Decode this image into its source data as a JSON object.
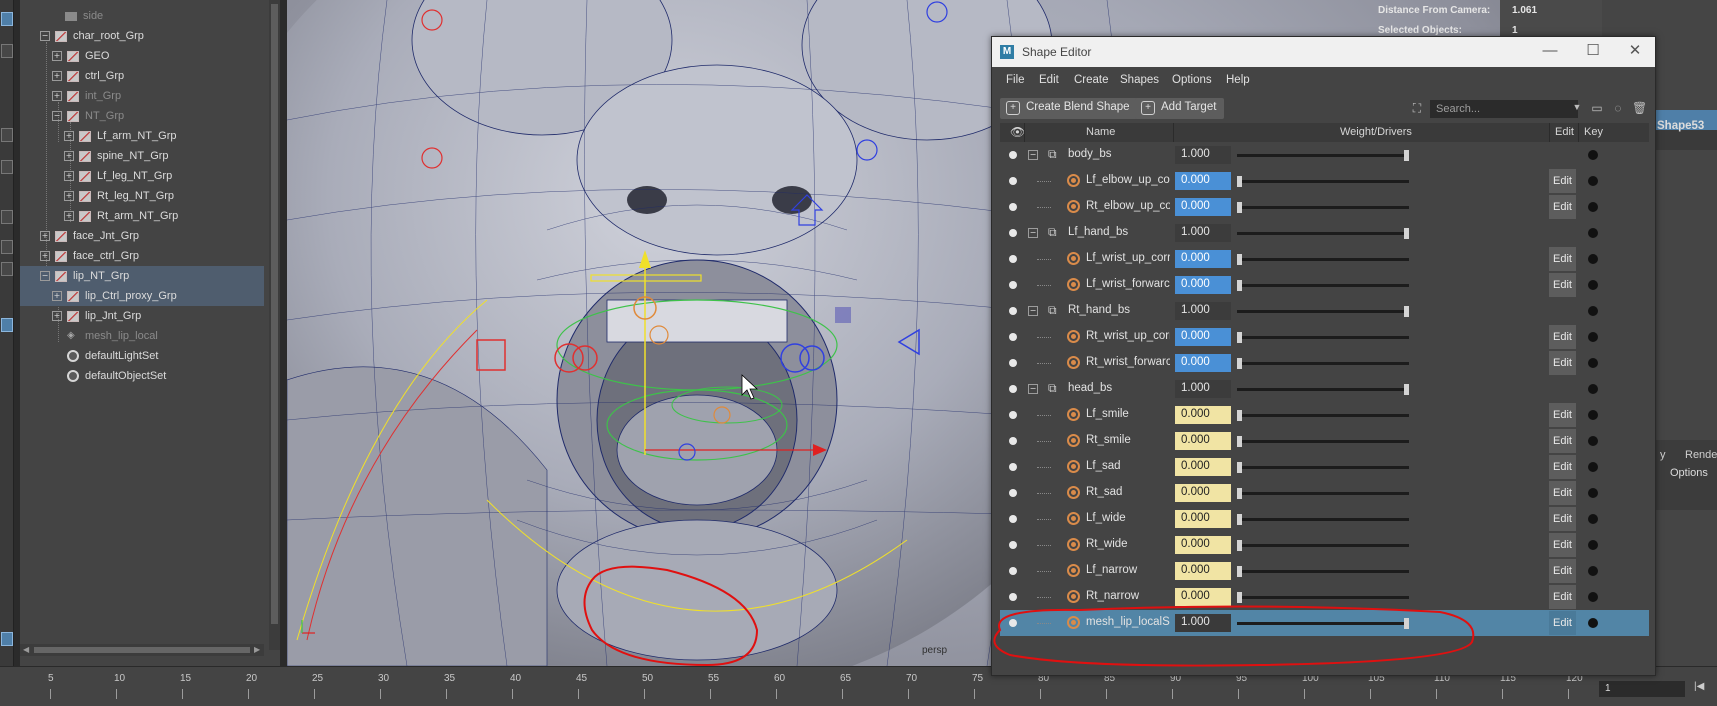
{
  "outliner": {
    "items": [
      {
        "label": "side",
        "dim": true
      },
      {
        "label": "char_root_Grp"
      },
      {
        "label": "GEO"
      },
      {
        "label": "ctrl_Grp"
      },
      {
        "label": "int_Grp",
        "dim": true
      },
      {
        "label": "NT_Grp",
        "dim": true
      },
      {
        "label": "Lf_arm_NT_Grp"
      },
      {
        "label": "spine_NT_Grp"
      },
      {
        "label": "Lf_leg_NT_Grp"
      },
      {
        "label": "Rt_leg_NT_Grp"
      },
      {
        "label": "Rt_arm_NT_Grp"
      },
      {
        "label": "face_Jnt_Grp"
      },
      {
        "label": "face_ctrl_Grp"
      },
      {
        "label": "lip_NT_Grp"
      },
      {
        "label": "lip_Ctrl_proxy_Grp"
      },
      {
        "label": "lip_Jnt_Grp"
      },
      {
        "label": "mesh_lip_local",
        "dim": true
      },
      {
        "label": "defaultLightSet"
      },
      {
        "label": "defaultObjectSet"
      }
    ]
  },
  "viewport": {
    "camera_label": "persp",
    "hud": {
      "distance_label": "Distance From Camera:",
      "distance_value": "1.061",
      "selected_label": "Selected Objects:",
      "selected_value": "1"
    }
  },
  "right_panel": {
    "shape_label": "Shape53",
    "tab1": "y",
    "tab2": "Rende",
    "options": "Options"
  },
  "shape_editor": {
    "title": "Shape Editor",
    "menu": [
      "File",
      "Edit",
      "Create",
      "Shapes",
      "Options",
      "Help"
    ],
    "create_blend_shape": "Create Blend Shape",
    "add_target": "Add Target",
    "search_placeholder": "Search...",
    "headers": {
      "name": "Name",
      "weight": "Weight/Drivers",
      "edit": "Edit",
      "key": "Key"
    },
    "edit_label": "Edit",
    "rows": [
      {
        "type": "bs",
        "name": "body_bs",
        "value": "1.000",
        "weight": 1.0
      },
      {
        "type": "target",
        "name": "Lf_elbow_up_co",
        "value": "0.000",
        "weight": 0.0,
        "color": "blue"
      },
      {
        "type": "target",
        "name": "Rt_elbow_up_co",
        "value": "0.000",
        "weight": 0.0,
        "color": "blue"
      },
      {
        "type": "bs",
        "name": "Lf_hand_bs",
        "value": "1.000",
        "weight": 1.0
      },
      {
        "type": "target",
        "name": "Lf_wrist_up_corr",
        "value": "0.000",
        "weight": 0.0,
        "color": "blue"
      },
      {
        "type": "target",
        "name": "Lf_wrist_forwarc",
        "value": "0.000",
        "weight": 0.0,
        "color": "blue"
      },
      {
        "type": "bs",
        "name": "Rt_hand_bs",
        "value": "1.000",
        "weight": 1.0
      },
      {
        "type": "target",
        "name": "Rt_wrist_up_corr",
        "value": "0.000",
        "weight": 0.0,
        "color": "blue"
      },
      {
        "type": "target",
        "name": "Rt_wrist_forwarc",
        "value": "0.000",
        "weight": 0.0,
        "color": "blue"
      },
      {
        "type": "bs",
        "name": "head_bs",
        "value": "1.000",
        "weight": 1.0
      },
      {
        "type": "target",
        "name": "Lf_smile",
        "value": "0.000",
        "weight": 0.0,
        "color": "yellow"
      },
      {
        "type": "target",
        "name": "Rt_smile",
        "value": "0.000",
        "weight": 0.0,
        "color": "yellow"
      },
      {
        "type": "target",
        "name": "Lf_sad",
        "value": "0.000",
        "weight": 0.0,
        "color": "yellow"
      },
      {
        "type": "target",
        "name": "Rt_sad",
        "value": "0.000",
        "weight": 0.0,
        "color": "yellow"
      },
      {
        "type": "target",
        "name": "Lf_wide",
        "value": "0.000",
        "weight": 0.0,
        "color": "yellow"
      },
      {
        "type": "target",
        "name": "Rt_wide",
        "value": "0.000",
        "weight": 0.0,
        "color": "yellow"
      },
      {
        "type": "target",
        "name": "Lf_narrow",
        "value": "0.000",
        "weight": 0.0,
        "color": "yellow"
      },
      {
        "type": "target",
        "name": "Rt_narrow",
        "value": "0.000",
        "weight": 0.0,
        "color": "yellow"
      },
      {
        "type": "target",
        "name": "mesh_lip_localSl",
        "value": "1.000",
        "weight": 1.0,
        "color": "plain",
        "selected": true
      }
    ]
  },
  "timeline": {
    "ticks": [
      "5",
      "10",
      "15",
      "20",
      "25",
      "30",
      "35",
      "40",
      "45",
      "50",
      "55",
      "60",
      "65",
      "70",
      "75",
      "80",
      "85",
      "90",
      "95",
      "100",
      "105",
      "110",
      "115",
      "120"
    ],
    "current_frame": "1"
  },
  "colors": {
    "selection": "#5285a6",
    "blue_field": "#4a90d6",
    "yellow_field": "#f1e4a4",
    "annotation_red": "#e01010"
  }
}
